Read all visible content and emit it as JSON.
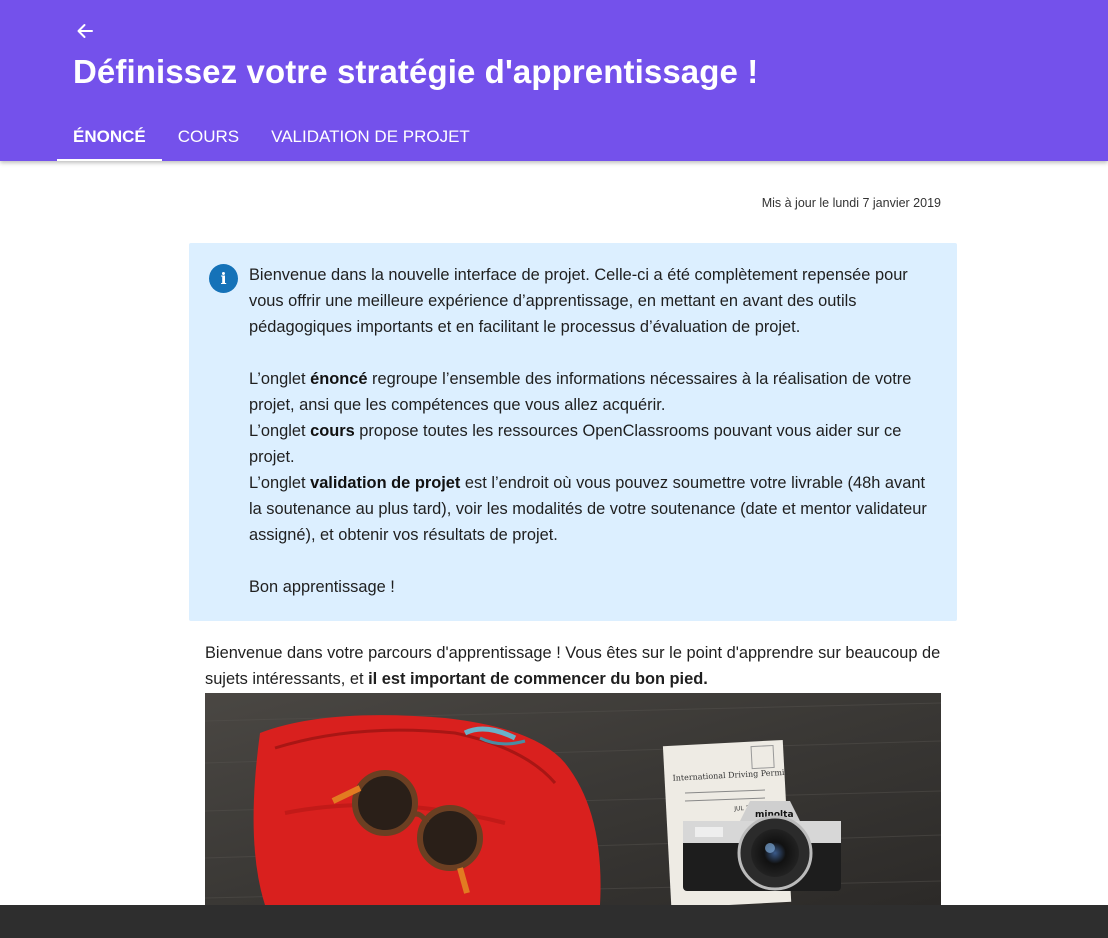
{
  "header": {
    "back_label": "←",
    "title": "Définissez votre stratégie d'apprentissage !",
    "bg_color": "#7451eb",
    "tabs": [
      {
        "label": "ÉNONCÉ",
        "active": true
      },
      {
        "label": "COURS",
        "active": false
      },
      {
        "label": "VALIDATION DE PROJET",
        "active": false
      }
    ]
  },
  "updated": "Mis à jour le lundi 7 janvier 2019",
  "info_box": {
    "icon": "info-icon",
    "bg_color": "#dcefff",
    "p1": "Bienvenue dans la nouvelle interface de projet. Celle-ci a été complètement repensée pour vous offrir une meilleure expérience d’apprentissage, en mettant en avant des outils pédagogiques importants et en facilitant le processus d’évaluation de projet.",
    "enonce_pre": "L’onglet ",
    "enonce_bold": "énoncé",
    "enonce_post": " regroupe l’ensemble des informations nécessaires à la réalisation de votre projet, ansi que les compétences que vous allez acquérir.",
    "cours_pre": "L’onglet ",
    "cours_bold": "cours",
    "cours_post": " propose toutes les ressources OpenClassrooms pouvant vous aider sur ce projet.",
    "validation_pre": "L’onglet ",
    "validation_bold": "validation de projet",
    "validation_post": " est l’endroit où vous pouvez soumettre votre livrable (48h avant la soutenance au plus tard), voir les modalités de votre soutenance (date et mentor validateur assigné), et obtenir vos résultats de projet.",
    "closing": "Bon apprentissage !"
  },
  "intro": {
    "text": "Bienvenue dans votre parcours d'apprentissage ! Vous êtes sur le point d'apprendre  sur beaucoup de sujets intéressants, et ",
    "bold": "il est important de commencer du bon pied."
  },
  "photo": {
    "permit_title": "International Driving Permit",
    "permit_date": "JUL 23 1968",
    "camera_brand": "minolta"
  }
}
